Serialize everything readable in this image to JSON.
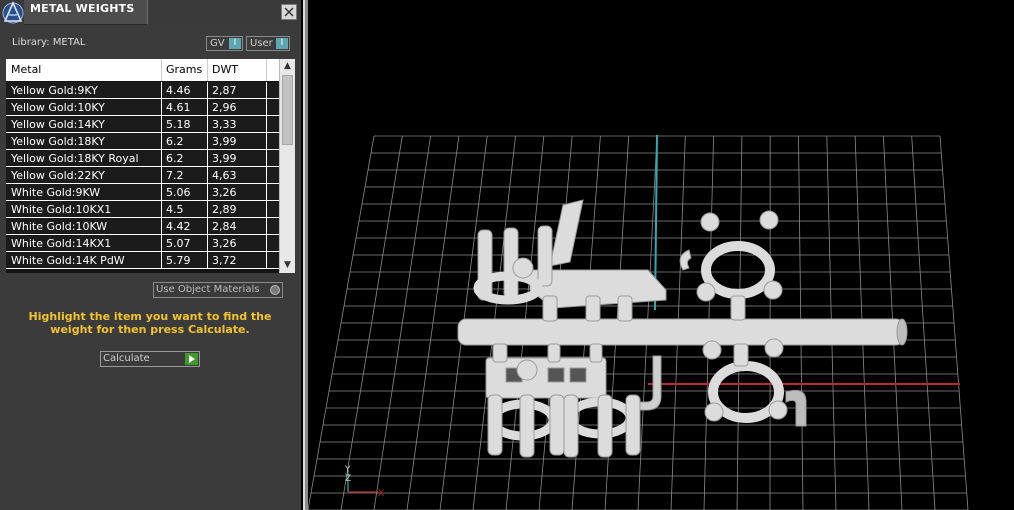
{
  "panel": {
    "title": "METAL WEIGHTS",
    "close_label": "X",
    "library_label": "Library: METAL",
    "toggles": [
      {
        "label": "GV",
        "indicator": "I"
      },
      {
        "label": "User",
        "indicator": "I"
      }
    ],
    "table": {
      "headers": [
        "Metal",
        "Grams",
        "DWT"
      ],
      "rows": [
        [
          "Yellow Gold:9KY",
          "4.46",
          "2,87"
        ],
        [
          "Yellow Gold:10KY",
          "4.61",
          "2,96"
        ],
        [
          "Yellow Gold:14KY",
          "5.18",
          "3,33"
        ],
        [
          "Yellow Gold:18KY",
          "6.2",
          "3,99"
        ],
        [
          "Yellow Gold:18KY Royal",
          "6.2",
          "3,99"
        ],
        [
          "Yellow Gold:22KY",
          "7.2",
          "4,63"
        ],
        [
          "White Gold:9KW",
          "5.06",
          "3,26"
        ],
        [
          "White Gold:10KX1",
          "4.5",
          "2,89"
        ],
        [
          "White Gold:10KW",
          "4.42",
          "2,84"
        ],
        [
          "White Gold:14KX1",
          "5.07",
          "3,26"
        ],
        [
          "White Gold:14K PdW",
          "5.79",
          "3,72"
        ]
      ],
      "scroll_up_glyph": "▲",
      "scroll_down_glyph": "▼"
    },
    "use_object_materials_label": "Use Object Materials",
    "instruction_text": "Highlight the item you want to find the weight for then press Calculate.",
    "calculate_label": "Calculate"
  },
  "viewport": {
    "background": "#000000",
    "grid_color": "#8a8a8a",
    "axis_x_color": "#c0282a",
    "axis_y_color": "#2fa9b5",
    "model_color": "#dcdcdc",
    "gizmo_labels": {
      "y": "Y",
      "z": "Z",
      "x": "X"
    }
  },
  "colors": {
    "panel_bg": "#3b3b3b",
    "instruction_color": "#f4c32b",
    "toggle_indicator": "#5fa7b3",
    "calc_go": "#3f9a2a"
  }
}
